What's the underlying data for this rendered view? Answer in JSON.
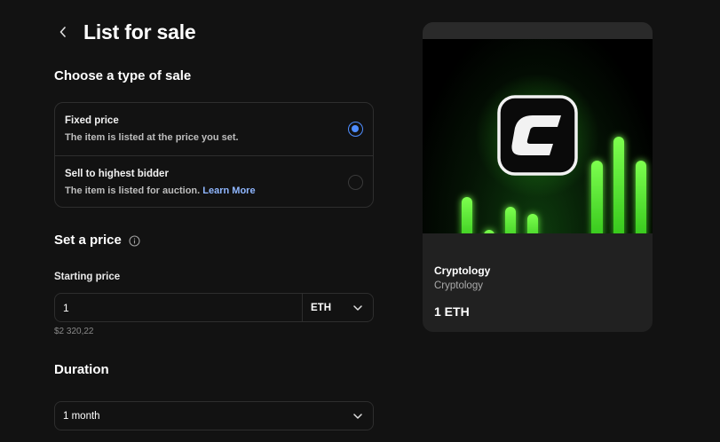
{
  "header": {
    "title": "List for sale",
    "back_icon": "chevron-left-icon"
  },
  "sale_type": {
    "heading": "Choose a type of sale",
    "options": [
      {
        "title": "Fixed price",
        "description": "The item is listed at the price you set.",
        "selected": true
      },
      {
        "title": "Sell to highest bidder",
        "description": "The item is listed for auction.",
        "link": "Learn More",
        "selected": false
      }
    ]
  },
  "price": {
    "heading": "Set a price",
    "info_icon": "info-icon",
    "starting_label": "Starting price",
    "value": "1",
    "currency": "ETH",
    "fiat_value": "$2 320,22"
  },
  "duration": {
    "heading": "Duration",
    "selected": "1 month"
  },
  "preview": {
    "name": "Cryptology",
    "collection": "Cryptology",
    "price": "1 ETH",
    "logo_letter": "C"
  },
  "colors": {
    "background": "#121212",
    "accent": "#4f8dff",
    "link": "#8fb6ff",
    "card": "#212121",
    "neon_green": "#5dff3a"
  }
}
